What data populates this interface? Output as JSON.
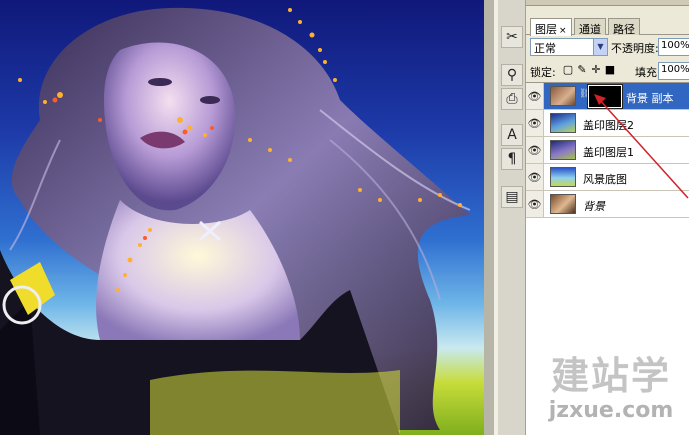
{
  "layers_panel": {
    "tabs": [
      {
        "label": "图层",
        "close": "×",
        "active": true
      },
      {
        "label": "通道",
        "active": false
      },
      {
        "label": "路径",
        "active": false
      }
    ],
    "blend_mode": "正常",
    "opacity_label": "不透明度:",
    "opacity_value": "100%",
    "lock_label": "锁定:",
    "fill_label": "填充:",
    "fill_value": "100%",
    "layers": [
      {
        "name": "背景 副本",
        "selected": true,
        "has_mask": true
      },
      {
        "name": "盖印图层2",
        "selected": false
      },
      {
        "name": "盖印图层1",
        "selected": false
      },
      {
        "name": "风景底图",
        "selected": false
      },
      {
        "name": "背景",
        "selected": false
      }
    ]
  },
  "tools": [
    "scissors-icon",
    "pin-icon",
    "stamp-icon",
    "character-icon",
    "paragraph-icon",
    "document-icon"
  ],
  "watermark": {
    "text": "建站学",
    "url": "jzxue.com"
  },
  "colors": {
    "selection": "#3167c0",
    "panel_bg": "#ece9d8",
    "annotation_arrow": "#d0222a"
  }
}
